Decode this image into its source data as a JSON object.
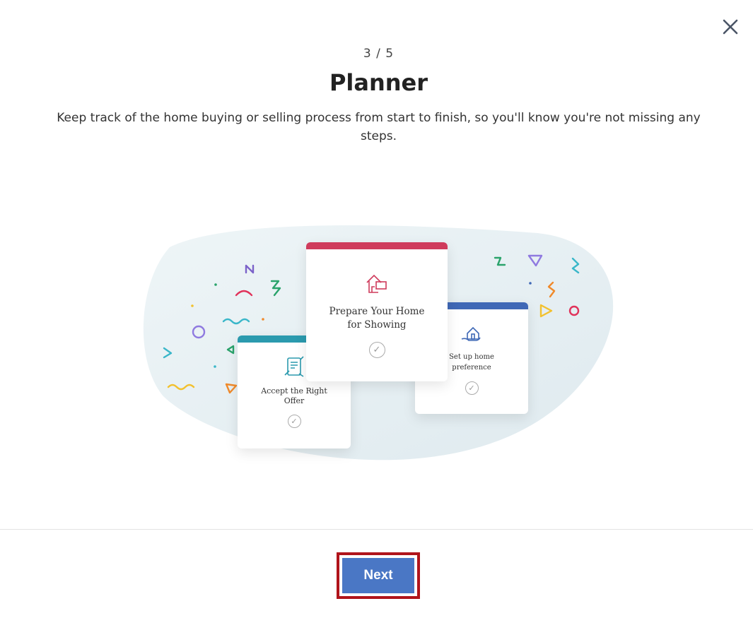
{
  "modal": {
    "step": "3 / 5",
    "title": "Planner",
    "description": "Keep track of the home buying or selling process from start to finish, so you'll know you're not missing any steps."
  },
  "cards": [
    {
      "label": "Accept the Right Offer",
      "color": "#2b9aae",
      "icon": "contract-signature-icon"
    },
    {
      "label": "Prepare Your Home for Showing",
      "color": "#cf3b5c",
      "icon": "house-sign-icon"
    },
    {
      "label": "Set up home preference",
      "color": "#3f68b6",
      "icon": "hand-house-icon"
    }
  ],
  "footer": {
    "next_label": "Next"
  },
  "icons": {
    "close": "close-icon"
  },
  "colors": {
    "accent": "#4a77c5",
    "highlight_border": "#b0141b"
  }
}
